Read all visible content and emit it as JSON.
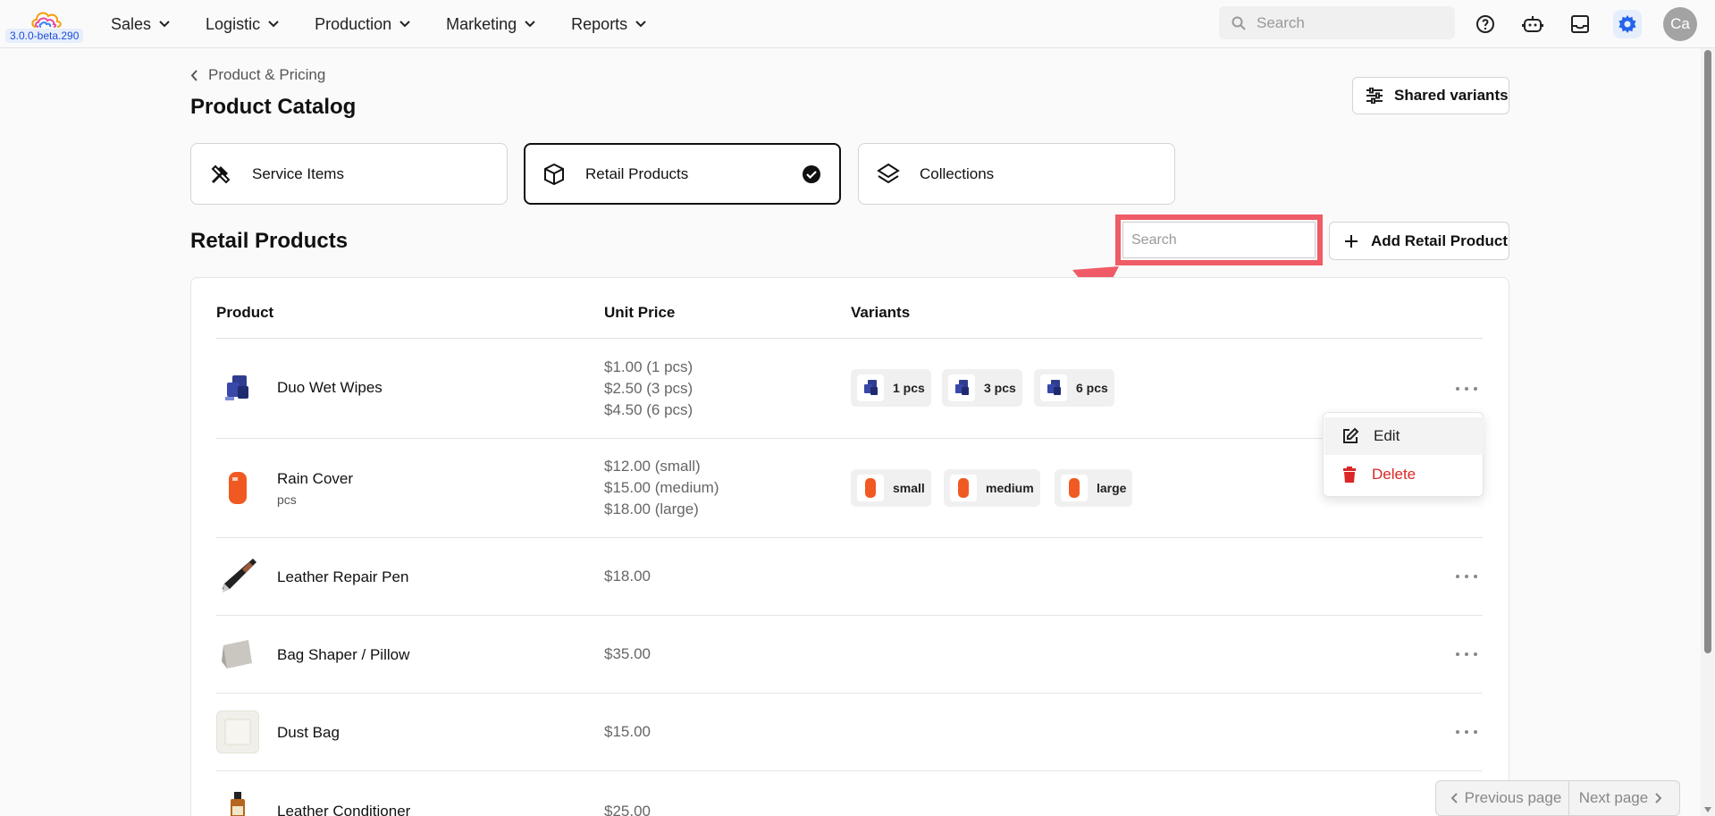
{
  "app": {
    "version": "3.0.0-beta.290"
  },
  "nav": [
    {
      "label": "Sales"
    },
    {
      "label": "Logistic"
    },
    {
      "label": "Production"
    },
    {
      "label": "Marketing"
    },
    {
      "label": "Reports"
    }
  ],
  "topbar": {
    "search_placeholder": "Search",
    "avatar_initials": "Ca"
  },
  "breadcrumb": {
    "label": "Product & Pricing"
  },
  "page": {
    "title": "Product Catalog",
    "shared_variants_label": "Shared variants"
  },
  "categories": [
    {
      "label": "Service Items",
      "icon": "tools-icon",
      "active": false
    },
    {
      "label": "Retail Products",
      "icon": "box-icon",
      "active": true
    },
    {
      "label": "Collections",
      "icon": "layers-icon",
      "active": false
    }
  ],
  "section": {
    "title": "Retail Products",
    "search_placeholder": "Search",
    "add_label": "Add Retail Product"
  },
  "table": {
    "columns": [
      "Product",
      "Unit Price",
      "Variants"
    ],
    "rows": [
      {
        "name": "Duo Wet Wipes",
        "unit": "",
        "prices": [
          "$1.00 (1 pcs)",
          "$2.50 (3 pcs)",
          "$4.50 (6 pcs)"
        ],
        "variants": [
          "1 pcs",
          "3 pcs",
          "6 pcs"
        ]
      },
      {
        "name": "Rain Cover",
        "unit": "pcs",
        "prices": [
          "$12.00 (small)",
          "$15.00 (medium)",
          "$18.00 (large)"
        ],
        "variants": [
          "small",
          "medium",
          "large"
        ]
      },
      {
        "name": "Leather Repair Pen",
        "unit": "",
        "prices": [
          "$18.00"
        ],
        "variants": []
      },
      {
        "name": "Bag Shaper / Pillow",
        "unit": "",
        "prices": [
          "$35.00"
        ],
        "variants": []
      },
      {
        "name": "Dust Bag",
        "unit": "",
        "prices": [
          "$15.00"
        ],
        "variants": []
      },
      {
        "name": "Leather Conditioner",
        "unit": "",
        "prices": [
          "$25.00"
        ],
        "variants": []
      }
    ]
  },
  "row_menu": {
    "edit_label": "Edit",
    "delete_label": "Delete"
  },
  "pagination": {
    "previous_label": "Previous page",
    "next_label": "Next page"
  },
  "colors": {
    "accent": "#2563eb",
    "danger": "#dc2626",
    "highlight": "#ef5b66"
  }
}
